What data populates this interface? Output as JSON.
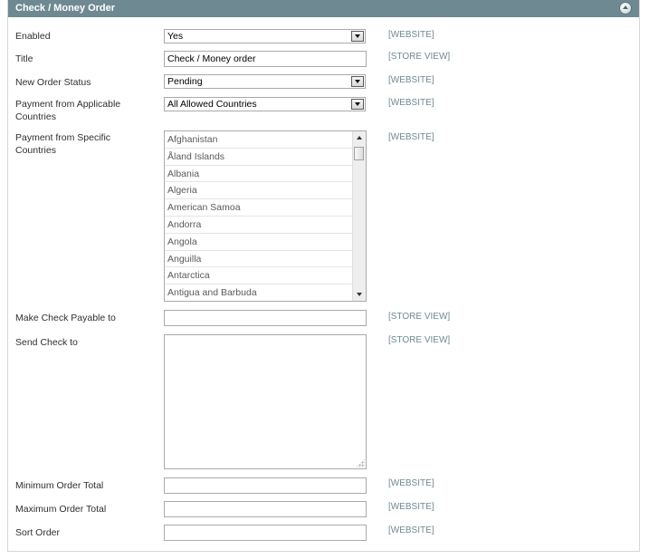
{
  "section": {
    "title": "Check / Money Order",
    "collapse_icon": "chevron-up-circle-icon"
  },
  "fields": {
    "enabled": {
      "label": "Enabled",
      "value": "Yes",
      "scope": "[WEBSITE]"
    },
    "title": {
      "label": "Title",
      "value": "Check / Money order",
      "scope": "[STORE VIEW]"
    },
    "new_order_status": {
      "label": "New Order Status",
      "value": "Pending",
      "scope": "[WEBSITE]"
    },
    "applicable_countries": {
      "label": "Payment from Applicable Countries",
      "value": "All Allowed Countries",
      "scope": "[WEBSITE]"
    },
    "specific_countries": {
      "label": "Payment from Specific Countries",
      "options": [
        "Afghanistan",
        "Åland Islands",
        "Albania",
        "Algeria",
        "American Samoa",
        "Andorra",
        "Angola",
        "Anguilla",
        "Antarctica",
        "Antigua and Barbuda"
      ],
      "scope": "[WEBSITE]"
    },
    "payable_to": {
      "label": "Make Check Payable to",
      "value": "",
      "scope": "[STORE VIEW]"
    },
    "send_check_to": {
      "label": "Send Check to",
      "value": "",
      "scope": "[STORE VIEW]"
    },
    "min_order_total": {
      "label": "Minimum Order Total",
      "value": "",
      "scope": "[WEBSITE]"
    },
    "max_order_total": {
      "label": "Maximum Order Total",
      "value": "",
      "scope": "[WEBSITE]"
    },
    "sort_order": {
      "label": "Sort Order",
      "value": "",
      "scope": "[WEBSITE]"
    }
  },
  "colors": {
    "header_bg": "#6f8992",
    "scope_text": "#6f8992",
    "border": "#aaaaaa"
  }
}
